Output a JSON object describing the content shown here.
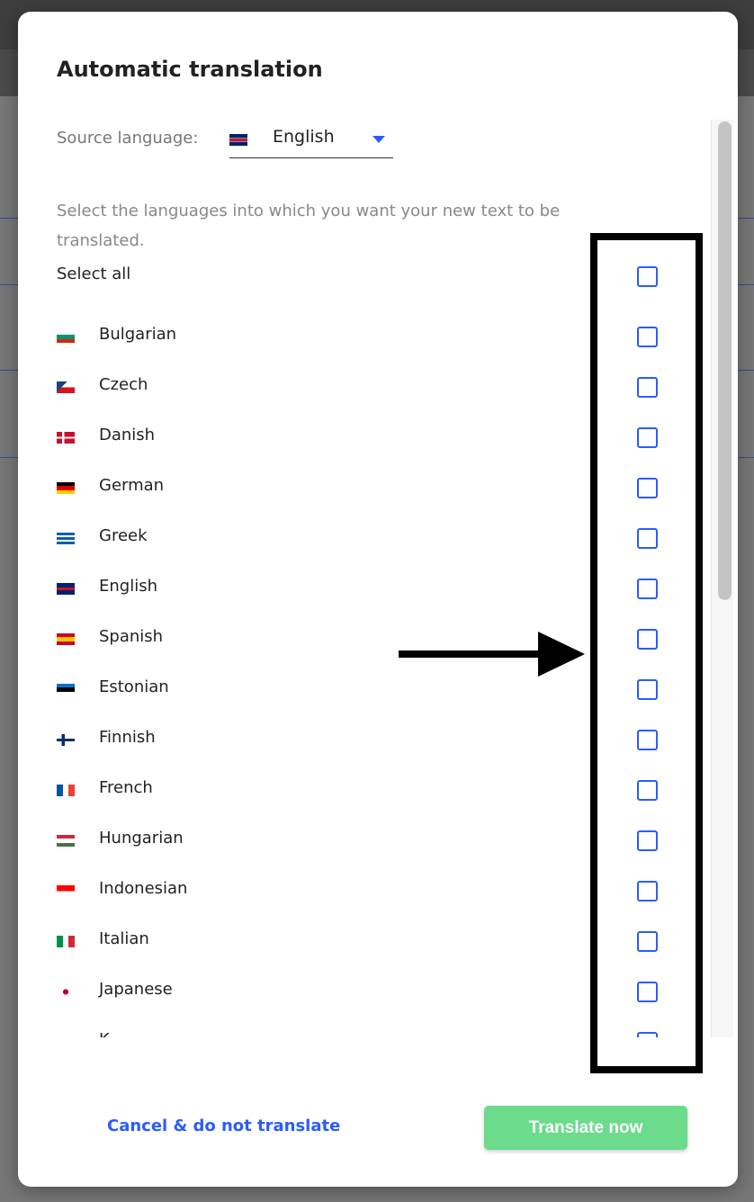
{
  "dialog": {
    "title": "Automatic translation",
    "source_label": "Source language:",
    "source_value": "English",
    "description": "Select the languages into which you want your new text to be translated.",
    "select_all": "Select all",
    "languages": [
      {
        "label": "Bulgarian",
        "checked": false,
        "flag": [
          "#ffffff",
          "#00966e",
          "#d62612"
        ]
      },
      {
        "label": "Czech",
        "checked": false,
        "flag": [
          "#ffffff",
          "#d7141a"
        ]
      },
      {
        "label": "Danish",
        "checked": false,
        "flag": [
          "#c8102e"
        ]
      },
      {
        "label": "German",
        "checked": false,
        "flag": [
          "#000000",
          "#dd0000",
          "#ffce00"
        ]
      },
      {
        "label": "Greek",
        "checked": false,
        "flag": [
          "#0d5eaf",
          "#ffffff",
          "#0d5eaf",
          "#ffffff",
          "#0d5eaf"
        ]
      },
      {
        "label": "English",
        "checked": false,
        "flag": [
          "#012169",
          "#c8102e",
          "#012169"
        ]
      },
      {
        "label": "Spanish",
        "checked": false,
        "flag": [
          "#c60b1e",
          "#ffc400",
          "#c60b1e"
        ]
      },
      {
        "label": "Estonian",
        "checked": false,
        "flag": [
          "#0072ce",
          "#000000",
          "#ffffff"
        ]
      },
      {
        "label": "Finnish",
        "checked": false,
        "flag": [
          "#ffffff",
          "#002f6c",
          "#ffffff"
        ]
      },
      {
        "label": "French",
        "checked": false,
        "flag": [
          "#0055a4",
          "#ffffff",
          "#ef4135"
        ]
      },
      {
        "label": "Hungarian",
        "checked": false,
        "flag": [
          "#ce2939",
          "#ffffff",
          "#477050"
        ]
      },
      {
        "label": "Indonesian",
        "checked": false,
        "flag": [
          "#ff0000",
          "#ff0000"
        ]
      },
      {
        "label": "Italian",
        "checked": false,
        "flag": [
          "#009246",
          "#ffffff",
          "#ce2b37"
        ]
      },
      {
        "label": "Japanese",
        "checked": false,
        "flag": [
          "#ffffff"
        ]
      },
      {
        "label": "K",
        "checked": false,
        "flag": [
          "#ffffff"
        ]
      }
    ],
    "cancel_label": "Cancel & do not translate",
    "translate_label": "Translate now"
  },
  "colors": {
    "accent": "#2a5cff",
    "primary_button": "#6cdb8c",
    "annotation": "#000000"
  }
}
